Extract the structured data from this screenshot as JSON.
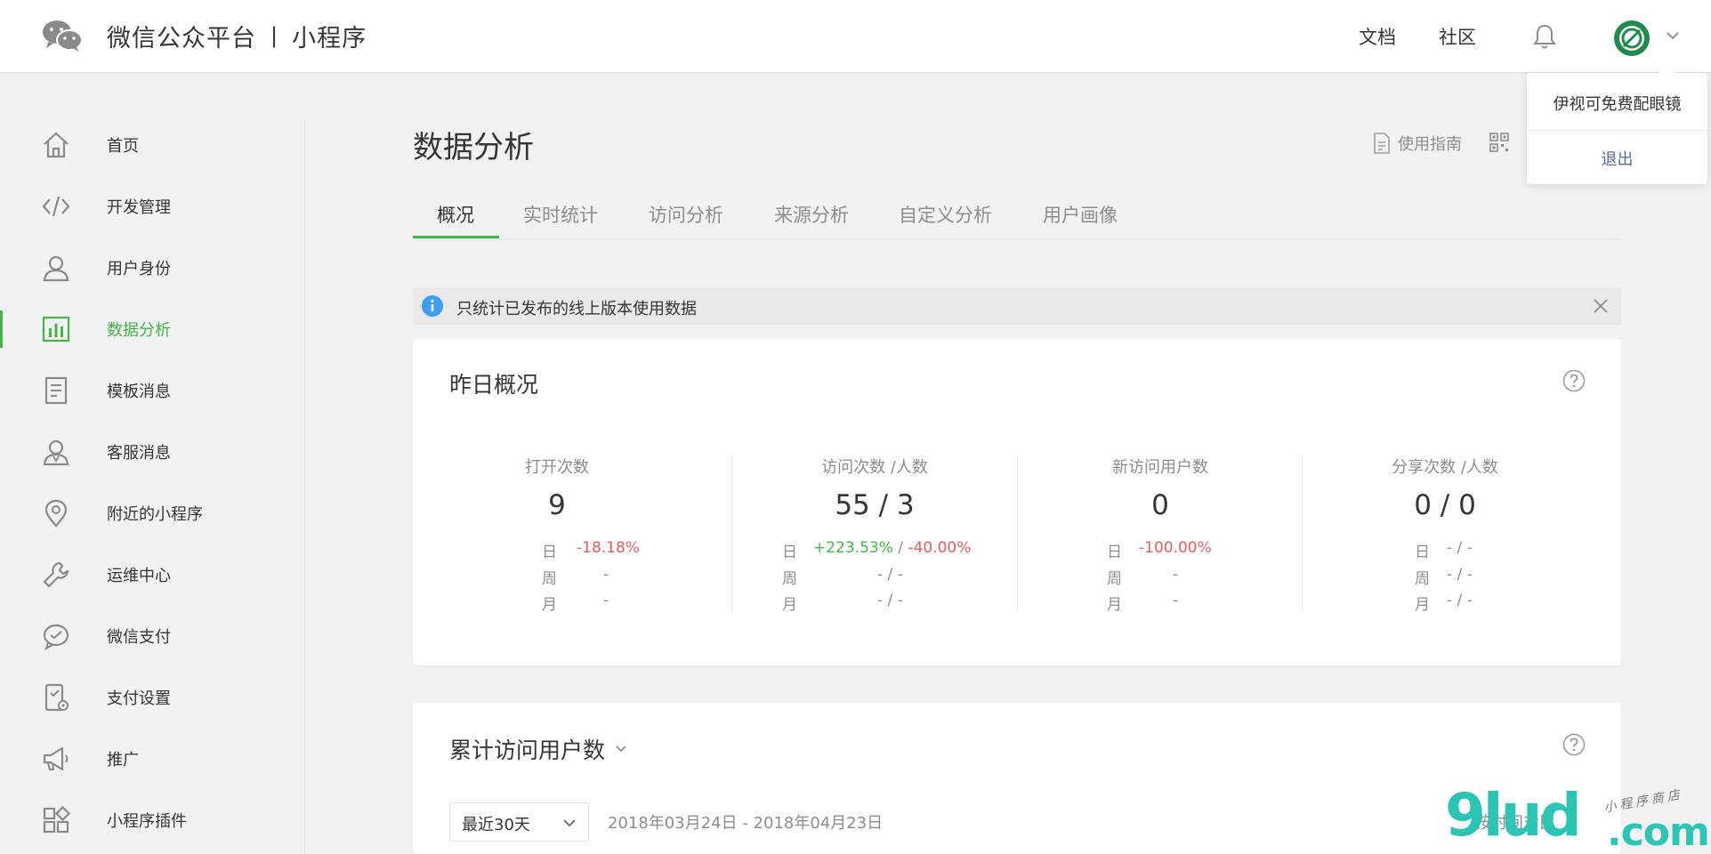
{
  "header": {
    "brand_name": "微信公众平台",
    "brand_separator": "|",
    "brand_product": "小程序",
    "nav_docs": "文档",
    "nav_community": "社区"
  },
  "account_menu": {
    "account_name": "伊视可免费配眼镜",
    "logout": "退出"
  },
  "sidebar": {
    "items": [
      {
        "label": "首页",
        "icon": "home-icon"
      },
      {
        "label": "开发管理",
        "icon": "code-icon"
      },
      {
        "label": "用户身份",
        "icon": "user-icon"
      },
      {
        "label": "数据分析",
        "icon": "bar-chart-icon",
        "active": true
      },
      {
        "label": "模板消息",
        "icon": "document-icon"
      },
      {
        "label": "客服消息",
        "icon": "customer-service-icon"
      },
      {
        "label": "附近的小程序",
        "icon": "location-pin-icon"
      },
      {
        "label": "运维中心",
        "icon": "wrench-icon"
      },
      {
        "label": "微信支付",
        "icon": "wechat-pay-icon"
      },
      {
        "label": "支付设置",
        "icon": "payment-settings-icon"
      },
      {
        "label": "推广",
        "icon": "megaphone-icon"
      },
      {
        "label": "小程序插件",
        "icon": "plugin-icon"
      }
    ]
  },
  "main": {
    "title": "数据分析",
    "guide_label": "使用指南",
    "tabs": [
      {
        "label": "概况",
        "active": true
      },
      {
        "label": "实时统计"
      },
      {
        "label": "访问分析"
      },
      {
        "label": "来源分析"
      },
      {
        "label": "自定义分析"
      },
      {
        "label": "用户画像"
      }
    ],
    "notice": "只统计已发布的线上版本使用数据"
  },
  "overview": {
    "title": "昨日概况",
    "row_labels": {
      "day": "日",
      "week": "周",
      "month": "月"
    },
    "stats": [
      {
        "label": "打开次数",
        "value": "9",
        "day": "-18.18%",
        "day_trend": "down",
        "week": "-",
        "month": "-"
      },
      {
        "label": "访问次数 /人数",
        "value": "55 / 3",
        "day_first": "+223.53%",
        "day_sep": " / ",
        "day_second": "-40.00%",
        "week": "- / -",
        "month": "- / -"
      },
      {
        "label": "新访问用户数",
        "value": "0",
        "day": "-100.00%",
        "day_trend": "down",
        "week": "-",
        "month": "-"
      },
      {
        "label": "分享次数 /人数",
        "value": "0 / 0",
        "day": "- / -",
        "day_trend": "muted",
        "week": "- / -",
        "month": "- / -"
      }
    ]
  },
  "cumulative": {
    "title": "累计访问用户数",
    "range_selected": "最近30天",
    "date_range": "2018年03月24日 - 2018年04月23日",
    "compare_label": "按时间对比"
  },
  "watermark": {
    "big": "9lud",
    "com": ".com",
    "small": "小程序商店"
  },
  "colors": {
    "accent_green": "#44b549",
    "negative_red": "#e15f63",
    "link_blue": "#576b95",
    "muted_gray": "#8d8d8d"
  }
}
